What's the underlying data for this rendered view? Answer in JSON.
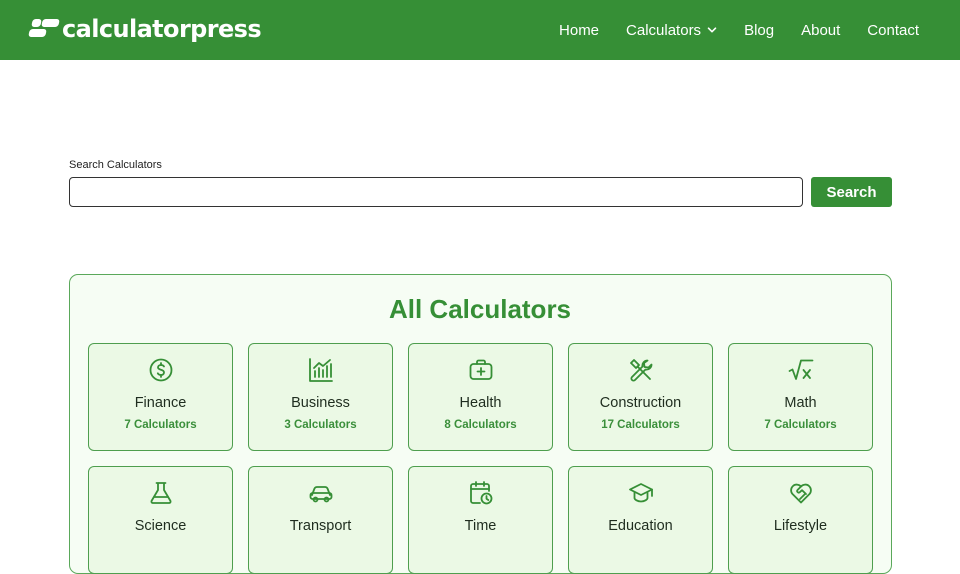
{
  "brand": {
    "name": "calculatorpress"
  },
  "nav": {
    "home": "Home",
    "calculators": "Calculators",
    "blog": "Blog",
    "about": "About",
    "contact": "Contact"
  },
  "search": {
    "label": "Search Calculators",
    "value": "",
    "placeholder": "",
    "button": "Search"
  },
  "section": {
    "title": "All Calculators"
  },
  "categories": [
    {
      "name": "Finance",
      "count": "7 Calculators",
      "icon": "dollar-circle-icon"
    },
    {
      "name": "Business",
      "count": "3 Calculators",
      "icon": "bar-chart-icon"
    },
    {
      "name": "Health",
      "count": "8 Calculators",
      "icon": "first-aid-kit-icon"
    },
    {
      "name": "Construction",
      "count": "17 Calculators",
      "icon": "tools-icon"
    },
    {
      "name": "Math",
      "count": "7 Calculators",
      "icon": "square-root-icon"
    },
    {
      "name": "Science",
      "count": "",
      "icon": "flask-icon"
    },
    {
      "name": "Transport",
      "count": "",
      "icon": "car-icon"
    },
    {
      "name": "Time",
      "count": "",
      "icon": "calendar-clock-icon"
    },
    {
      "name": "Education",
      "count": "",
      "icon": "graduation-cap-icon"
    },
    {
      "name": "Lifestyle",
      "count": "",
      "icon": "heart-handshake-icon"
    }
  ],
  "colors": {
    "brand": "#368f36",
    "panel_bg": "#f6fdf4",
    "card_bg": "#ebf9e5"
  }
}
